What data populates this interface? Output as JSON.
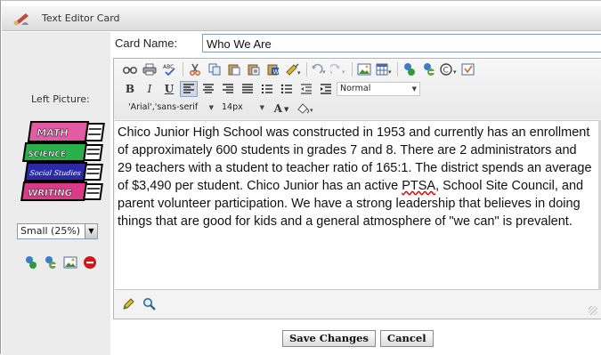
{
  "window": {
    "title": "Text Editor Card",
    "title_icon": "editor-card-icon"
  },
  "left": {
    "picture_label": "Left Picture:",
    "picture_icon": "school-books-clipart",
    "picture_book_labels": [
      "MATH",
      "SCIENCE",
      "Social Studies",
      "WRITING"
    ],
    "size_value": "Small (25%)",
    "actions": [
      "select-image-icon",
      "remove-image-icon",
      "image-properties-icon",
      "delete-icon"
    ]
  },
  "card_name": {
    "label": "Card Name:",
    "value": "Who We Are"
  },
  "toolbar": {
    "row1_icons": [
      "find",
      "print",
      "spellcheck",
      "cut",
      "copy",
      "paste",
      "paste-text",
      "paste-word",
      "format-painter",
      "undo",
      "redo",
      "insert-image",
      "insert-table",
      "insert-link",
      "remove-link",
      "insert-special-char",
      "insert-media"
    ],
    "bold": "B",
    "italic": "I",
    "underline": "U",
    "paragraph_format": "Normal",
    "font_family": "'Arial','sans-serif",
    "font_size": "14px",
    "font_color_label": "A"
  },
  "content": {
    "text_before": "Chico Junior High School was constructed in 1953 and currently has an enrollment of approximately 600 students in grades 7 and 8. There are 2 administrators and 29 teachers with a student to teacher ratio of 165:1. The district spends an average of $3,490 per student. Chico Junior has an active ",
    "misspelled": "PTSA",
    "text_after": ", School Site Council, and parent volunteer participation. We have a strong leadership that believes in doing things that are good for kids and a general atmosphere of \"we can\" is prevalent."
  },
  "footer": {
    "tools": [
      "edit-pencil-icon",
      "zoom-icon"
    ]
  },
  "buttons": {
    "save": "Save Changes",
    "cancel": "Cancel"
  },
  "colors": {
    "accent_blue": "#3a5ea8",
    "delete_red": "#d01818"
  }
}
